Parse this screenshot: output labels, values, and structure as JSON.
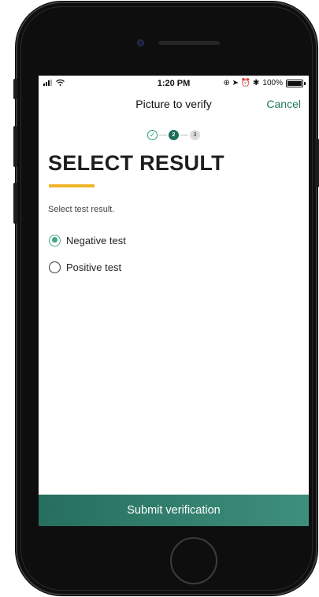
{
  "status_bar": {
    "time": "1:20 PM",
    "right_icons": "⊕ ➤ ⏰ ✱",
    "battery": "100%"
  },
  "nav": {
    "title": "Picture to verify",
    "cancel": "Cancel"
  },
  "stepper": {
    "step1": "✓",
    "step2": "2",
    "step3": "3"
  },
  "page": {
    "title": "SELECT RESULT",
    "instruction": "Select test result."
  },
  "options": [
    {
      "label": "Negative test",
      "selected": true
    },
    {
      "label": "Positive test",
      "selected": false
    }
  ],
  "submit_label": "Submit verification",
  "colors": {
    "accent": "#1f7a5e",
    "underline": "#f0b429",
    "submit_bg": "#2f7d6b"
  }
}
